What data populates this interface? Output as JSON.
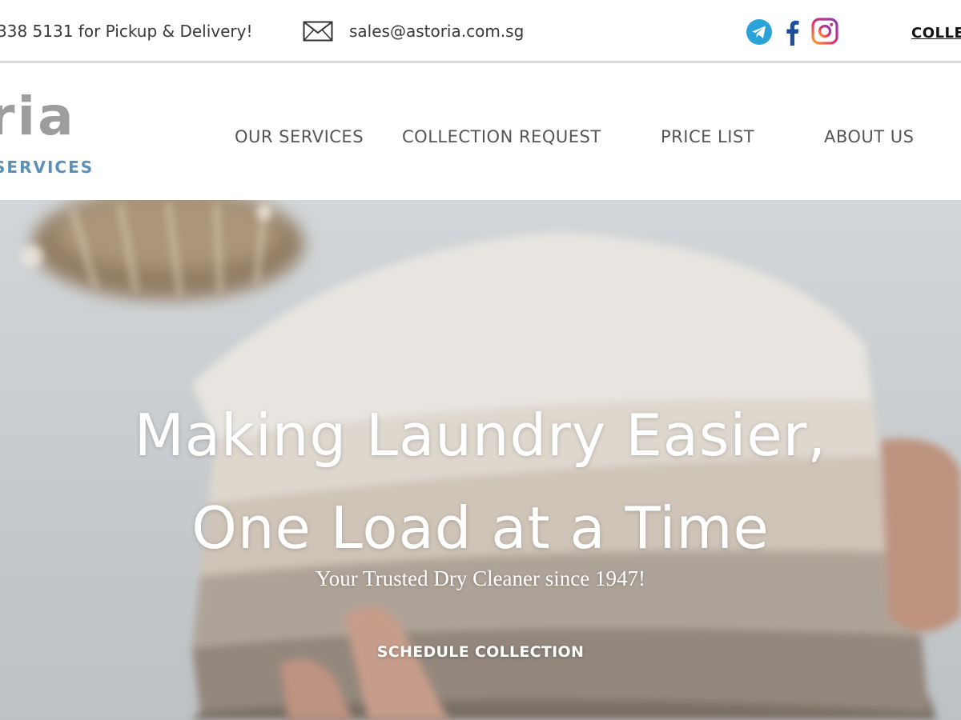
{
  "topbar": {
    "phone_text": "338 5131 for Pickup & Delivery!",
    "email": "sales@astoria.com.sg",
    "social_icons": [
      "telegram-icon",
      "facebook-icon",
      "instagram-icon"
    ],
    "collection_link": "COLLE"
  },
  "header": {
    "logo": {
      "wordmark": "ria",
      "tagline": "SERVICES"
    },
    "nav": [
      {
        "label": "OUR SERVICES"
      },
      {
        "label": "COLLECTION REQUEST"
      },
      {
        "label": "PRICE LIST"
      },
      {
        "label": "ABOUT US"
      }
    ]
  },
  "hero": {
    "title_line1": "Making Laundry Easier,",
    "title_line2": "One Load at a Time",
    "subtitle": "Your Trusted Dry Cleaner since 1947!",
    "cta_label": "SCHEDULE COLLECTION"
  },
  "colors": {
    "logo_grey": "#9d9d9d",
    "logo_blue": "#5a8fb8",
    "telegram": "#2aa3d9",
    "facebook": "#1b4f9c",
    "instagram": "#d6247a"
  }
}
